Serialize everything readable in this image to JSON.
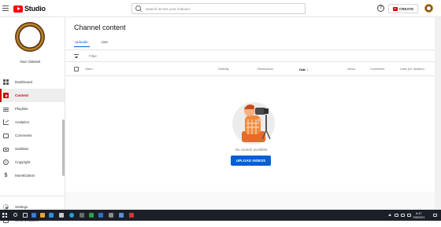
{
  "header": {
    "logo_text": "Studio",
    "search_placeholder": "Search across your channel",
    "help_symbol": "?",
    "create_label": "CREATE"
  },
  "sidebar": {
    "channel_name": "Your channel",
    "items": [
      {
        "label": "Dashboard",
        "icon": "dashboard-icon"
      },
      {
        "label": "Content",
        "icon": "content-icon",
        "active": true
      },
      {
        "label": "Playlists",
        "icon": "playlists-icon"
      },
      {
        "label": "Analytics",
        "icon": "analytics-icon"
      },
      {
        "label": "Comments",
        "icon": "comments-icon"
      },
      {
        "label": "Subtitles",
        "icon": "subtitles-icon"
      },
      {
        "label": "Copyright",
        "icon": "copyright-icon",
        "symbol": "©"
      },
      {
        "label": "Monetization",
        "icon": "monetization-icon",
        "symbol": "$"
      }
    ],
    "bottom_items": [
      {
        "label": "Settings",
        "icon": "gear-icon"
      },
      {
        "label": "Send feedback",
        "icon": "feedback-icon"
      }
    ]
  },
  "main": {
    "title": "Channel content",
    "tabs": [
      {
        "label": "Uploads",
        "active": true
      },
      {
        "label": "Live"
      }
    ],
    "filter_label": "Filter",
    "columns": [
      {
        "label": "Video"
      },
      {
        "label": "Visibility"
      },
      {
        "label": "Restrictions"
      },
      {
        "label": "Date",
        "sort": "↓",
        "bold": true
      },
      {
        "label": "Views"
      },
      {
        "label": "Comments"
      },
      {
        "label": "Likes (vs. dislikes)"
      }
    ],
    "empty_message": "No content available",
    "upload_button": "UPLOAD VIDEOS"
  },
  "taskbar": {
    "time": "9:47",
    "date": "7/8/2021"
  },
  "colors": {
    "brand_red": "#ff0000",
    "active_red": "#cc0000",
    "accent_blue": "#065fd4",
    "taskbar": "#1b1f27"
  }
}
